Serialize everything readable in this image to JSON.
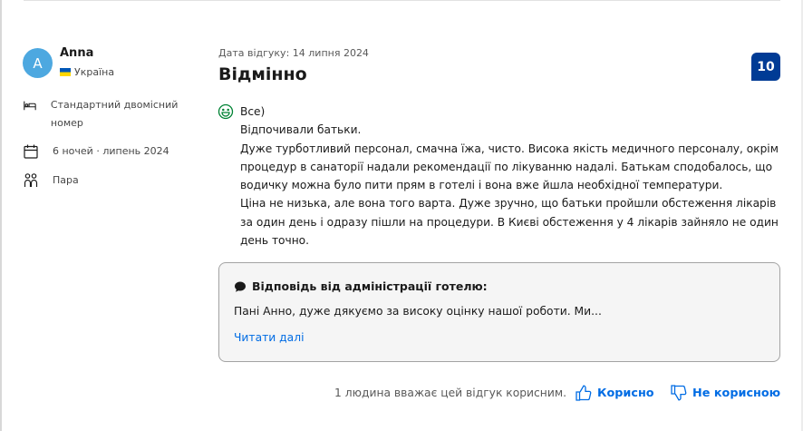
{
  "reviewer": {
    "initial": "A",
    "name": "Anna",
    "country": "Україна"
  },
  "stay_info": {
    "room": "Стандартний двомісний номер",
    "nights": "6 ночей · липень 2024",
    "traveler_type": "Пара"
  },
  "review": {
    "date": "Дата відгуку: 14 липня 2024",
    "title": "Відмінно",
    "score": "10",
    "positive_lines": [
      "Все)",
      "Відпочивали батьки.",
      "Дуже турботливий персонал, смачна їжа, чисто. Висока якість медичного персоналу, окрім",
      "процедур в санаторії надали рекомендації по лікуванню надалі. Батькам сподобалось, що",
      "водичку можна було пити прям в готелі і вона вже йшла необхідної температури.",
      "Ціна не низька, але вона того варта. Дуже зручно, що батьки пройшли обстеження лікарів",
      "за один день і одразу пішли на процедури. В Києві обстеження у 4 лікарів зайняло не один",
      "день точно."
    ]
  },
  "reply": {
    "heading": "Відповідь від адміністрації готелю:",
    "text": "Пані Анно, дуже дякуємо за високу оцінку нашої роботи. Ми...",
    "read_more": "Читати далі"
  },
  "helpful": {
    "count_text": "1 людина вважає цей відгук корисним.",
    "yes_label": "Корисно",
    "no_label": "Не корисною"
  },
  "colors": {
    "score_bg": "#003b95",
    "link": "#006ce4",
    "avatar": "#4da8e0",
    "smile": "#008234"
  }
}
